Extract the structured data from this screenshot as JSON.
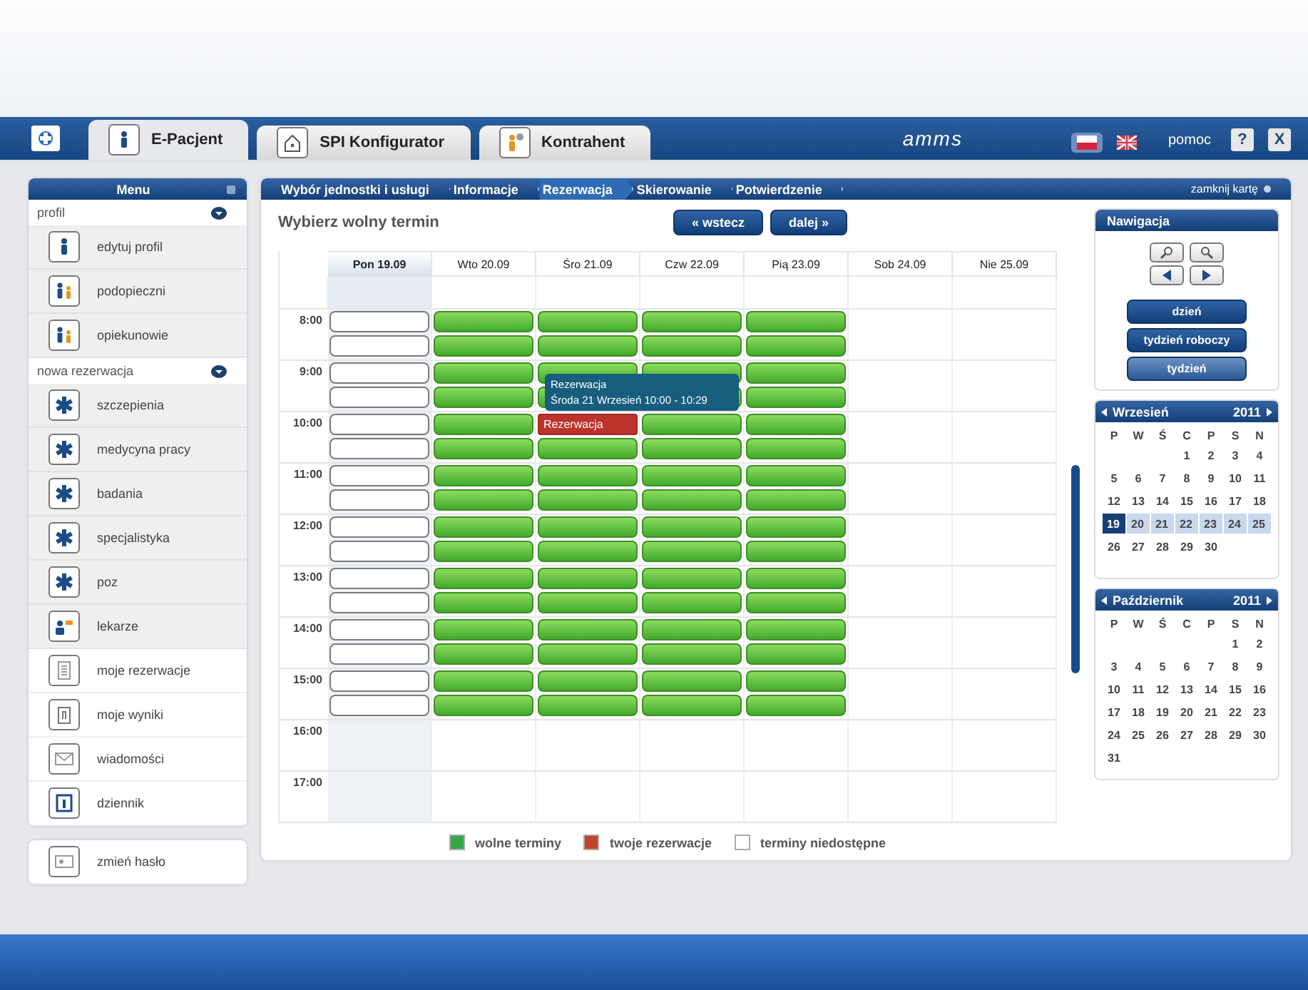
{
  "app_bar": {
    "tabs": [
      {
        "label": "E-Pacjent",
        "kind": "person",
        "selected": true
      },
      {
        "label": "SPI Konfigurator",
        "kind": "house",
        "selected": false
      },
      {
        "label": "Kontrahent",
        "kind": "person-orange",
        "selected": false
      }
    ],
    "brand": "amms",
    "languages": [
      {
        "kind": "pl",
        "selected": true
      },
      {
        "kind": "en",
        "selected": false
      }
    ],
    "help_label": "pomoc",
    "help_button": "?",
    "close_button": "X"
  },
  "menu": {
    "title": "Menu",
    "sections": [
      {
        "label": "profil",
        "expanded": true,
        "items": [
          {
            "label": "edytuj profil",
            "kind": "person"
          },
          {
            "label": "podopieczni",
            "kind": "people"
          },
          {
            "label": "opiekunowie",
            "kind": "people"
          }
        ]
      },
      {
        "label": "nowa rezerwacja",
        "expanded": true,
        "items": [
          {
            "label": "szczepienia",
            "kind": "medical"
          },
          {
            "label": "medycyna pracy",
            "kind": "medical"
          },
          {
            "label": "badania",
            "kind": "medical"
          },
          {
            "label": "specjalistyka",
            "kind": "medical"
          },
          {
            "label": "poz",
            "kind": "medical"
          },
          {
            "label": "lekarze",
            "kind": "doctor"
          }
        ]
      }
    ],
    "items": [
      {
        "label": "moje rezerwacje",
        "kind": "document"
      },
      {
        "label": "moje wyniki",
        "kind": "clipboard"
      },
      {
        "label": "wiadomości",
        "kind": "mail"
      },
      {
        "label": "dziennik",
        "kind": "diary"
      }
    ],
    "footer_items": [
      {
        "label": "zmień hasło",
        "kind": "card"
      }
    ]
  },
  "wizard": {
    "steps": [
      {
        "label": "Wybór jednostki i usługi",
        "selected": false
      },
      {
        "label": "Informacje",
        "selected": false
      },
      {
        "label": "Rezerwacja",
        "selected": true
      },
      {
        "label": "Skierowanie",
        "selected": false
      },
      {
        "label": "Potwierdzenie",
        "selected": false
      }
    ],
    "close_label": "zamknij kartę"
  },
  "schedule": {
    "title": "Wybierz wolny termin",
    "back_button": "« wstecz",
    "next_button": "dalej »",
    "hours": [
      "8:00",
      "9:00",
      "10:00",
      "11:00",
      "12:00",
      "13:00",
      "14:00",
      "15:00",
      "16:00",
      "17:00"
    ],
    "days": [
      {
        "label": "Pon 19.09",
        "selected": true,
        "slots": [
          {
            "kind": "unavailable"
          },
          {
            "kind": "unavailable"
          },
          {
            "kind": "unavailable"
          },
          {
            "kind": "unavailable"
          },
          {
            "kind": "unavailable"
          },
          {
            "kind": "unavailable"
          },
          {
            "kind": "unavailable"
          },
          {
            "kind": "unavailable"
          },
          {
            "kind": "unavailable"
          },
          {
            "kind": "unavailable"
          },
          {
            "kind": "unavailable"
          },
          {
            "kind": "unavailable"
          },
          {
            "kind": "unavailable"
          },
          {
            "kind": "unavailable"
          },
          {
            "kind": "unavailable"
          },
          {
            "kind": "unavailable"
          }
        ]
      },
      {
        "label": "Wto 20.09",
        "selected": false,
        "slots": [
          {
            "kind": "free"
          },
          {
            "kind": "free"
          },
          {
            "kind": "free"
          },
          {
            "kind": "free"
          },
          {
            "kind": "free"
          },
          {
            "kind": "free"
          },
          {
            "kind": "free"
          },
          {
            "kind": "free"
          },
          {
            "kind": "free"
          },
          {
            "kind": "free"
          },
          {
            "kind": "free"
          },
          {
            "kind": "free"
          },
          {
            "kind": "free"
          },
          {
            "kind": "free"
          },
          {
            "kind": "free"
          },
          {
            "kind": "free"
          }
        ]
      },
      {
        "label": "Śro 21.09",
        "selected": false,
        "slots": [
          {
            "kind": "free"
          },
          {
            "kind": "free"
          },
          {
            "kind": "free"
          },
          {
            "kind": "free"
          },
          {
            "kind": "reserved",
            "label": "Rezerwacja",
            "tooltip": {
              "title": "Rezerwacja",
              "text": "Środa 21 Wrzesień 10:00 - 10:29"
            }
          },
          {
            "kind": "free"
          },
          {
            "kind": "free"
          },
          {
            "kind": "free"
          },
          {
            "kind": "free"
          },
          {
            "kind": "free"
          },
          {
            "kind": "free"
          },
          {
            "kind": "free"
          },
          {
            "kind": "free"
          },
          {
            "kind": "free"
          },
          {
            "kind": "free"
          },
          {
            "kind": "free"
          }
        ]
      },
      {
        "label": "Czw 22.09",
        "selected": false,
        "slots": [
          {
            "kind": "free"
          },
          {
            "kind": "free"
          },
          {
            "kind": "free"
          },
          {
            "kind": "free"
          },
          {
            "kind": "free"
          },
          {
            "kind": "free"
          },
          {
            "kind": "free"
          },
          {
            "kind": "free"
          },
          {
            "kind": "free"
          },
          {
            "kind": "free"
          },
          {
            "kind": "free"
          },
          {
            "kind": "free"
          },
          {
            "kind": "free"
          },
          {
            "kind": "free"
          },
          {
            "kind": "free"
          },
          {
            "kind": "free"
          }
        ]
      },
      {
        "label": "Pią 23.09",
        "selected": false,
        "slots": [
          {
            "kind": "free"
          },
          {
            "kind": "free"
          },
          {
            "kind": "free"
          },
          {
            "kind": "free"
          },
          {
            "kind": "free"
          },
          {
            "kind": "free"
          },
          {
            "kind": "free"
          },
          {
            "kind": "free"
          },
          {
            "kind": "free"
          },
          {
            "kind": "free"
          },
          {
            "kind": "free"
          },
          {
            "kind": "free"
          },
          {
            "kind": "free"
          },
          {
            "kind": "free"
          },
          {
            "kind": "free"
          },
          {
            "kind": "free"
          }
        ]
      },
      {
        "label": "Sob 24.09",
        "selected": false
      },
      {
        "label": "Nie 25.09",
        "selected": false
      }
    ],
    "legend": [
      {
        "label": "wolne terminy",
        "color": "#33a84a"
      },
      {
        "label": "twoje rezerwacje",
        "color": "#c0442a"
      },
      {
        "label": "terminy niedostępne",
        "color": "#ffffff"
      }
    ]
  },
  "navigation": {
    "title": "Nawigacja",
    "views": [
      {
        "label": "dzień",
        "selected": false
      },
      {
        "label": "tydzień roboczy",
        "selected": false
      },
      {
        "label": "tydzień",
        "selected": true
      }
    ]
  },
  "calendars": [
    {
      "month": "Wrzesień",
      "year": "2011",
      "weekdays": [
        "P",
        "W",
        "Ś",
        "C",
        "P",
        "S",
        "N"
      ],
      "weeks": [
        {
          "highlighted": false,
          "days": [
            {
              "label": "1",
              "selected": false
            },
            {
              "label": "2",
              "selected": false
            },
            {
              "label": "3",
              "selected": false
            },
            {
              "label": "4",
              "selected": false
            }
          ]
        },
        {
          "highlighted": false,
          "days": [
            {
              "label": "5",
              "selected": false
            },
            {
              "label": "6",
              "selected": false
            },
            {
              "label": "7",
              "selected": false
            },
            {
              "label": "8",
              "selected": false
            },
            {
              "label": "9",
              "selected": false
            },
            {
              "label": "10",
              "selected": false
            },
            {
              "label": "11",
              "selected": false
            }
          ]
        },
        {
          "highlighted": false,
          "days": [
            {
              "label": "12",
              "selected": false
            },
            {
              "label": "13",
              "selected": false
            },
            {
              "label": "14",
              "selected": false
            },
            {
              "label": "15",
              "selected": false
            },
            {
              "label": "16",
              "selected": false
            },
            {
              "label": "17",
              "selected": false
            },
            {
              "label": "18",
              "selected": false
            }
          ]
        },
        {
          "highlighted": true,
          "days": [
            {
              "label": "19",
              "selected": true
            },
            {
              "label": "20",
              "selected": false
            },
            {
              "label": "21",
              "selected": false
            },
            {
              "label": "22",
              "selected": false
            },
            {
              "label": "23",
              "selected": false
            },
            {
              "label": "24",
              "selected": false
            },
            {
              "label": "25",
              "selected": false
            }
          ]
        },
        {
          "highlighted": false,
          "days": [
            {
              "label": "26",
              "selected": false
            },
            {
              "label": "27",
              "selected": false
            },
            {
              "label": "28",
              "selected": false
            },
            {
              "label": "29",
              "selected": false
            },
            {
              "label": "30",
              "selected": false
            }
          ]
        }
      ]
    },
    {
      "month": "Październik",
      "year": "2011",
      "weekdays": [
        "P",
        "W",
        "Ś",
        "C",
        "P",
        "S",
        "N"
      ],
      "weeks": [
        {
          "highlighted": false,
          "days": [
            {
              "label": "1",
              "selected": false
            },
            {
              "label": "2",
              "selected": false
            }
          ]
        },
        {
          "highlighted": false,
          "days": [
            {
              "label": "3",
              "selected": false
            },
            {
              "label": "4",
              "selected": false
            },
            {
              "label": "5",
              "selected": false
            },
            {
              "label": "6",
              "selected": false
            },
            {
              "label": "7",
              "selected": false
            },
            {
              "label": "8",
              "selected": false
            },
            {
              "label": "9",
              "selected": false
            }
          ]
        },
        {
          "highlighted": false,
          "days": [
            {
              "label": "10",
              "selected": false
            },
            {
              "label": "11",
              "selected": false
            },
            {
              "label": "12",
              "selected": false
            },
            {
              "label": "13",
              "selected": false
            },
            {
              "label": "14",
              "selected": false
            },
            {
              "label": "15",
              "selected": false
            },
            {
              "label": "16",
              "selected": false
            }
          ]
        },
        {
          "highlighted": false,
          "days": [
            {
              "label": "17",
              "selected": false
            },
            {
              "label": "18",
              "selected": false
            },
            {
              "label": "19",
              "selected": false
            },
            {
              "label": "20",
              "selected": false
            },
            {
              "label": "21",
              "selected": false
            },
            {
              "label": "22",
              "selected": false
            },
            {
              "label": "23",
              "selected": false
            }
          ]
        },
        {
          "highlighted": false,
          "days": [
            {
              "label": "24",
              "selected": false
            },
            {
              "label": "25",
              "selected": false
            },
            {
              "label": "26",
              "selected": false
            },
            {
              "label": "27",
              "selected": false
            },
            {
              "label": "28",
              "selected": false
            },
            {
              "label": "29",
              "selected": false
            },
            {
              "label": "30",
              "selected": false
            }
          ]
        },
        {
          "highlighted": false,
          "days": [
            {
              "label": "31",
              "selected": false
            }
          ]
        }
      ]
    }
  ]
}
